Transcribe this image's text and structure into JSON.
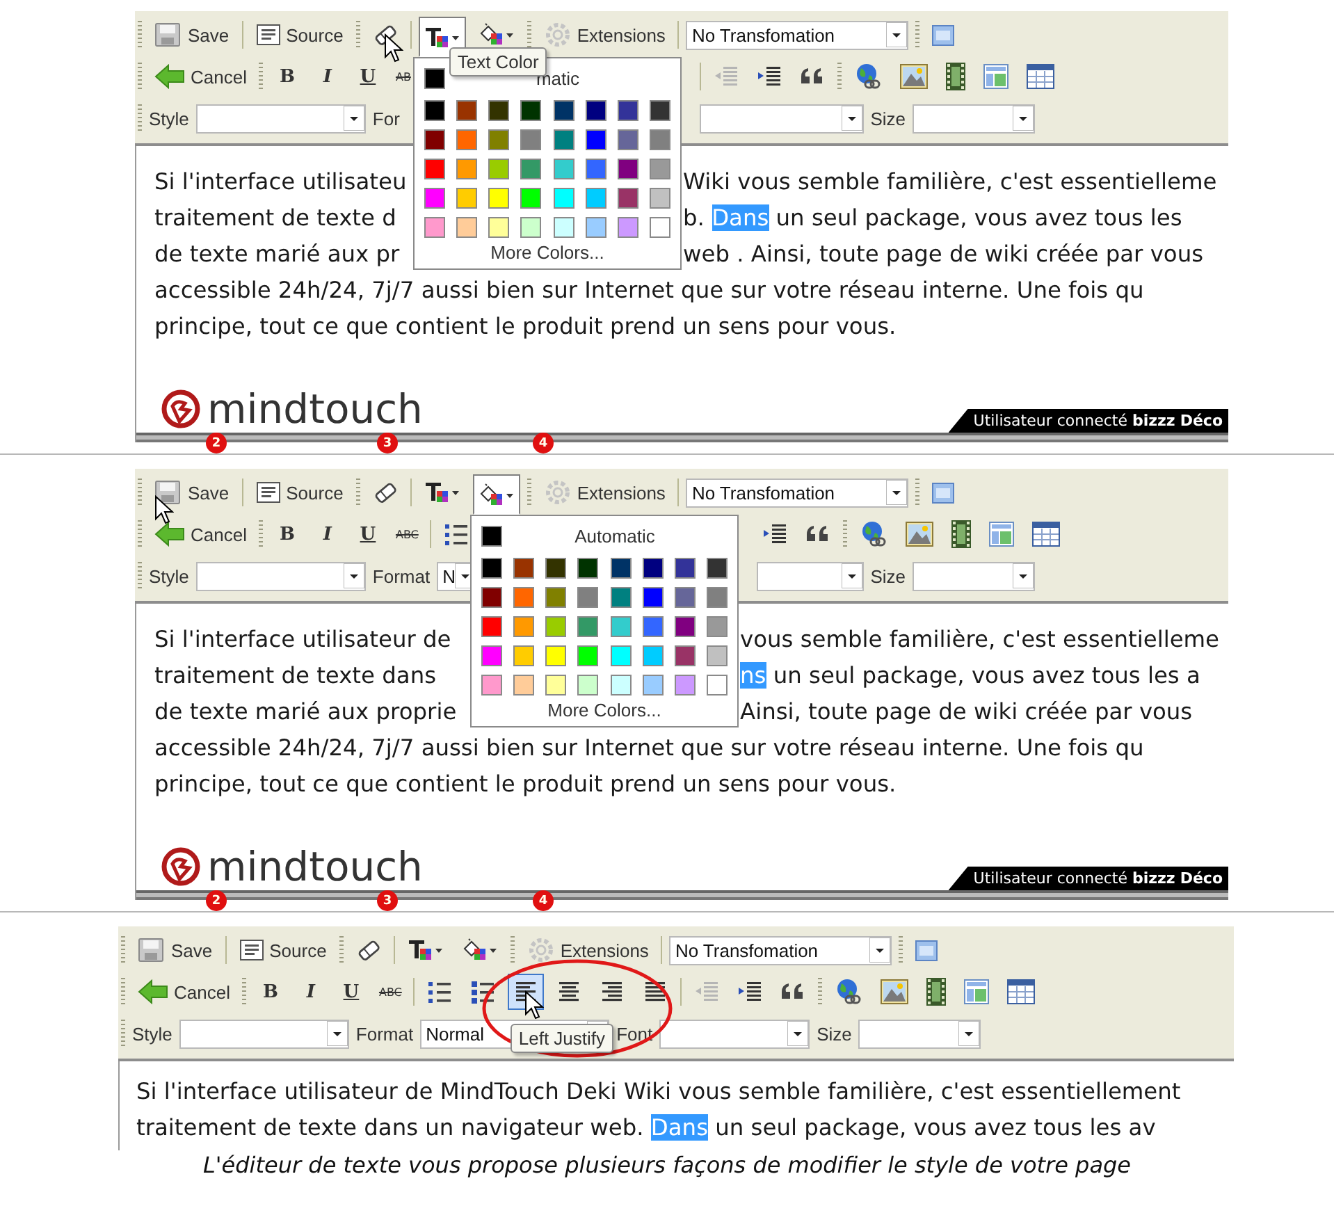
{
  "panels": [
    {
      "toolbar": [
        {
          "items": [
            {
              "kind": "grip"
            },
            {
              "kind": "save",
              "label": "Save"
            },
            {
              "kind": "sep"
            },
            {
              "kind": "source",
              "label": "Source"
            },
            {
              "kind": "grip"
            },
            {
              "kind": "eraser",
              "hovered": true
            },
            {
              "kind": "sep"
            },
            {
              "kind": "fgcolor",
              "pressed": true,
              "tooltip": "Text Color"
            },
            {
              "kind": "bgcolor",
              "pressed": false
            },
            {
              "kind": "grip"
            },
            {
              "kind": "extensions",
              "label": "Extensions"
            },
            {
              "kind": "sep"
            },
            {
              "kind": "transform",
              "value": "No Transfomation"
            },
            {
              "kind": "grip"
            },
            {
              "kind": "maximize"
            }
          ]
        },
        {
          "items": [
            {
              "kind": "grip"
            },
            {
              "kind": "cancel",
              "label": "Cancel"
            },
            {
              "kind": "grip"
            },
            {
              "kind": "bold",
              "label": "B"
            },
            {
              "kind": "italic",
              "label": "I"
            },
            {
              "kind": "underline",
              "label": "U"
            },
            {
              "kind": "strike",
              "label": "AB"
            }
          ],
          "after_popup": [
            {
              "kind": "sep"
            },
            {
              "kind": "outdent"
            },
            {
              "kind": "indent"
            },
            {
              "kind": "quote"
            },
            {
              "kind": "grip"
            },
            {
              "kind": "link"
            },
            {
              "kind": "image"
            },
            {
              "kind": "media"
            },
            {
              "kind": "template"
            },
            {
              "kind": "table"
            }
          ]
        },
        {
          "items": [
            {
              "kind": "grip"
            },
            {
              "kind": "label",
              "label": "Style"
            },
            {
              "kind": "style"
            },
            {
              "kind": "label",
              "label": "For"
            }
          ],
          "after_popup": [
            {
              "kind": "font"
            },
            {
              "kind": "label",
              "label": "Size"
            },
            {
              "kind": "size"
            }
          ]
        }
      ],
      "popup": {
        "kind": "fgcolor",
        "automatic_option": {
          "color": "#000000",
          "label": "matic"
        },
        "more_label": "More Colors...",
        "swatch_rows": [
          [
            {
              "color": "#000000"
            },
            {
              "color": "#993300"
            },
            {
              "color": "#333300"
            },
            {
              "color": "#003300"
            },
            {
              "color": "#003366"
            },
            {
              "color": "#000080"
            },
            {
              "color": "#333399"
            },
            {
              "color": "#333333"
            }
          ],
          [
            {
              "color": "#800000"
            },
            {
              "color": "#ff6600"
            },
            {
              "color": "#808000"
            },
            {
              "color": "#808080"
            },
            {
              "color": "#008080"
            },
            {
              "color": "#0000ff"
            },
            {
              "color": "#666699"
            },
            {
              "color": "#808080"
            }
          ],
          [
            {
              "color": "#ff0000"
            },
            {
              "color": "#ff9900"
            },
            {
              "color": "#99cc00"
            },
            {
              "color": "#339966"
            },
            {
              "color": "#33cccc"
            },
            {
              "color": "#3366ff"
            },
            {
              "color": "#800080"
            },
            {
              "color": "#999999"
            }
          ],
          [
            {
              "color": "#ff00ff"
            },
            {
              "color": "#ffcc00"
            },
            {
              "color": "#ffff00"
            },
            {
              "color": "#00ff00"
            },
            {
              "color": "#00ffff"
            },
            {
              "color": "#00ccff"
            },
            {
              "color": "#993366"
            },
            {
              "color": "#c0c0c0"
            }
          ],
          [
            {
              "color": "#ff99cc"
            },
            {
              "color": "#ffcc99"
            },
            {
              "color": "#ffff99"
            },
            {
              "color": "#ccffcc"
            },
            {
              "color": "#ccffff"
            },
            {
              "color": "#99ccff"
            },
            {
              "color": "#cc99ff"
            },
            {
              "color": "#ffffff"
            }
          ]
        ]
      },
      "text_lines": [
        {
          "before": [
            {
              "text": "Si l'interface utilisateu",
              "highlighted": false
            }
          ],
          "after": [
            {
              "text": "Wiki vous semble familière, c'est essentielleme",
              "highlighted": false
            }
          ]
        },
        {
          "before": [
            {
              "text": "traitement de texte d",
              "highlighted": false
            }
          ],
          "after": [
            {
              "text": "b. ",
              "highlighted": false
            },
            {
              "text": "Dans",
              "highlighted": true
            },
            {
              "text": " un seul package, vous avez tous les",
              "highlighted": false
            }
          ]
        },
        {
          "before": [
            {
              "text": "de texte marié aux pr",
              "highlighted": false
            }
          ],
          "after": [
            {
              "text": "web . Ainsi, toute page de wiki créée par vous",
              "highlighted": false
            }
          ]
        },
        {
          "segments": [
            {
              "text": "accessible 24h/24, 7j/7 aussi bien sur Internet que sur votre réseau interne. Une fois qu",
              "highlighted": false
            }
          ]
        },
        {
          "segments": [
            {
              "text": "principe, tout ce que contient le produit prend un sens pour vous.",
              "highlighted": false
            }
          ]
        }
      ],
      "footer": {
        "logo": "mindtouch",
        "markers": [
          "2",
          "3",
          "4"
        ],
        "user_label": "Utilisateur connecté **bizzz**  **Déco**"
      }
    },
    {
      "toolbar": [
        {
          "items": [
            {
              "kind": "grip",
              "hovered": true
            },
            {
              "kind": "save",
              "label": "Save"
            },
            {
              "kind": "sep"
            },
            {
              "kind": "source",
              "label": "Source"
            },
            {
              "kind": "grip"
            },
            {
              "kind": "eraser"
            },
            {
              "kind": "sep"
            },
            {
              "kind": "fgcolor",
              "pressed": false
            },
            {
              "kind": "bgcolor",
              "pressed": true
            },
            {
              "kind": "grip"
            },
            {
              "kind": "extensions",
              "label": "Extensions"
            },
            {
              "kind": "sep"
            },
            {
              "kind": "transform",
              "value": "No Transfomation"
            },
            {
              "kind": "grip"
            },
            {
              "kind": "maximize"
            }
          ]
        },
        {
          "items": [
            {
              "kind": "grip"
            },
            {
              "kind": "cancel",
              "label": "Cancel"
            },
            {
              "kind": "grip"
            },
            {
              "kind": "bold",
              "label": "B"
            },
            {
              "kind": "italic",
              "label": "I"
            },
            {
              "kind": "underline",
              "label": "U"
            },
            {
              "kind": "strike",
              "label": "ABC"
            },
            {
              "kind": "sep"
            },
            {
              "kind": "numlist"
            }
          ],
          "after_popup": [
            {
              "kind": "indent"
            },
            {
              "kind": "quote"
            },
            {
              "kind": "grip"
            },
            {
              "kind": "link"
            },
            {
              "kind": "image"
            },
            {
              "kind": "media"
            },
            {
              "kind": "template"
            },
            {
              "kind": "table"
            }
          ]
        },
        {
          "items": [
            {
              "kind": "grip"
            },
            {
              "kind": "label",
              "label": "Style"
            },
            {
              "kind": "style"
            },
            {
              "kind": "label",
              "label": "Format"
            },
            {
              "kind": "format",
              "value": "N"
            }
          ],
          "after_popup": [
            {
              "kind": "font"
            },
            {
              "kind": "label",
              "label": "Size"
            },
            {
              "kind": "size"
            }
          ]
        }
      ],
      "popup": {
        "kind": "bgcolor",
        "automatic_option": {
          "color": "#000000",
          "label": "Automatic"
        },
        "more_label": "More Colors...",
        "swatch_rows": [
          [
            {
              "color": "#000000"
            },
            {
              "color": "#993300"
            },
            {
              "color": "#333300"
            },
            {
              "color": "#003300"
            },
            {
              "color": "#003366"
            },
            {
              "color": "#000080"
            },
            {
              "color": "#333399"
            },
            {
              "color": "#333333"
            }
          ],
          [
            {
              "color": "#800000"
            },
            {
              "color": "#ff6600"
            },
            {
              "color": "#808000"
            },
            {
              "color": "#808080"
            },
            {
              "color": "#008080"
            },
            {
              "color": "#0000ff"
            },
            {
              "color": "#666699"
            },
            {
              "color": "#808080"
            }
          ],
          [
            {
              "color": "#ff0000"
            },
            {
              "color": "#ff9900"
            },
            {
              "color": "#99cc00"
            },
            {
              "color": "#339966"
            },
            {
              "color": "#33cccc"
            },
            {
              "color": "#3366ff"
            },
            {
              "color": "#800080"
            },
            {
              "color": "#999999"
            }
          ],
          [
            {
              "color": "#ff00ff"
            },
            {
              "color": "#ffcc00"
            },
            {
              "color": "#ffff00"
            },
            {
              "color": "#00ff00"
            },
            {
              "color": "#00ffff"
            },
            {
              "color": "#00ccff"
            },
            {
              "color": "#993366"
            },
            {
              "color": "#c0c0c0"
            }
          ],
          [
            {
              "color": "#ff99cc"
            },
            {
              "color": "#ffcc99"
            },
            {
              "color": "#ffff99"
            },
            {
              "color": "#ccffcc"
            },
            {
              "color": "#ccffff"
            },
            {
              "color": "#99ccff"
            },
            {
              "color": "#cc99ff"
            },
            {
              "color": "#ffffff"
            }
          ]
        ]
      },
      "text_lines": [
        {
          "before": [
            {
              "text": "Si l'interface utilisateur de",
              "highlighted": false
            }
          ],
          "after": [
            {
              "text": "vous semble familière, c'est essentielleme",
              "highlighted": false
            }
          ]
        },
        {
          "before": [
            {
              "text": "traitement de texte dans",
              "highlighted": false
            }
          ],
          "after": [
            {
              "text": "ns",
              "highlighted": true
            },
            {
              "text": " un seul package, vous avez tous les a",
              "highlighted": false
            }
          ]
        },
        {
          "before": [
            {
              "text": "de texte marié aux proprie",
              "highlighted": false
            }
          ],
          "after": [
            {
              "text": "Ainsi, toute page de wiki créée par vous",
              "highlighted": false
            }
          ]
        },
        {
          "segments": [
            {
              "text": "accessible 24h/24, 7j/7 aussi bien sur Internet que sur votre réseau interne. Une fois qu",
              "highlighted": false
            }
          ]
        },
        {
          "segments": [
            {
              "text": "principe, tout ce que contient le produit prend un sens pour vous.",
              "highlighted": false
            }
          ]
        }
      ],
      "footer": {
        "logo": "mindtouch",
        "markers": [
          "2",
          "3",
          "4"
        ],
        "user_label": "Utilisateur connecté **bizzz**  **Déco**"
      }
    },
    {
      "toolbar": [
        {
          "items": [
            {
              "kind": "grip"
            },
            {
              "kind": "save",
              "label": "Save"
            },
            {
              "kind": "sep"
            },
            {
              "kind": "source",
              "label": "Source"
            },
            {
              "kind": "grip"
            },
            {
              "kind": "eraser"
            },
            {
              "kind": "sep"
            },
            {
              "kind": "fgcolor",
              "pressed": false
            },
            {
              "kind": "bgcolor",
              "pressed": false
            },
            {
              "kind": "grip"
            },
            {
              "kind": "extensions",
              "label": "Extensions"
            },
            {
              "kind": "sep"
            },
            {
              "kind": "transform",
              "value": "No Transfomation"
            },
            {
              "kind": "grip"
            },
            {
              "kind": "maximize"
            }
          ]
        },
        {
          "items": [
            {
              "kind": "grip"
            },
            {
              "kind": "cancel",
              "label": "Cancel"
            },
            {
              "kind": "grip"
            },
            {
              "kind": "bold",
              "label": "B"
            },
            {
              "kind": "italic",
              "label": "I"
            },
            {
              "kind": "underline",
              "label": "U"
            },
            {
              "kind": "strike",
              "label": "ABC"
            },
            {
              "kind": "sep"
            },
            {
              "kind": "numlist"
            },
            {
              "kind": "bullist"
            },
            {
              "kind": "alignleft",
              "pressed": true,
              "hovered": true,
              "circled": true,
              "tooltip": "Left Justify"
            },
            {
              "kind": "aligncenter",
              "pressed": false
            },
            {
              "kind": "alignright",
              "pressed": false
            },
            {
              "kind": "justify",
              "pressed": false
            },
            {
              "kind": "sep"
            },
            {
              "kind": "outdent"
            },
            {
              "kind": "indent"
            },
            {
              "kind": "quote"
            },
            {
              "kind": "grip"
            },
            {
              "kind": "link"
            },
            {
              "kind": "image"
            },
            {
              "kind": "media"
            },
            {
              "kind": "template"
            },
            {
              "kind": "table"
            }
          ]
        },
        {
          "items": [
            {
              "kind": "grip"
            },
            {
              "kind": "label",
              "label": "Style"
            },
            {
              "kind": "style"
            },
            {
              "kind": "label",
              "label": "Format"
            },
            {
              "kind": "format",
              "value": "Normal"
            },
            {
              "kind": "label",
              "label": "Font"
            },
            {
              "kind": "font"
            },
            {
              "kind": "label",
              "label": "Size"
            },
            {
              "kind": "size"
            }
          ]
        }
      ],
      "text_lines": [
        {
          "segments": [
            {
              "text": "Si l'interface utilisateur de MindTouch Deki Wiki vous semble familière, c'est essentiellement",
              "highlighted": false
            }
          ]
        },
        {
          "segments": [
            {
              "text": "traitement de texte dans un navigateur web. ",
              "highlighted": false
            },
            {
              "text": "Dans",
              "highlighted": true
            },
            {
              "text": " un seul package, vous avez tous les av",
              "highlighted": false
            }
          ]
        }
      ]
    }
  ],
  "caption": "L'éditeur de texte vous propose plusieurs façons de modifier le style de votre page"
}
